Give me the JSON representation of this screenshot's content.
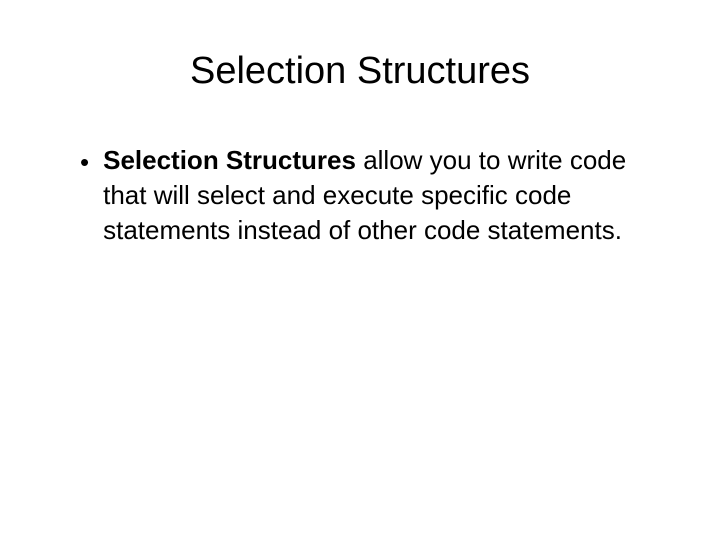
{
  "slide": {
    "title": "Selection Structures",
    "bullet": {
      "bold_part": "Selection Structures",
      "rest": " allow you to write code that will select and execute specific code statements instead of other code statements."
    }
  }
}
